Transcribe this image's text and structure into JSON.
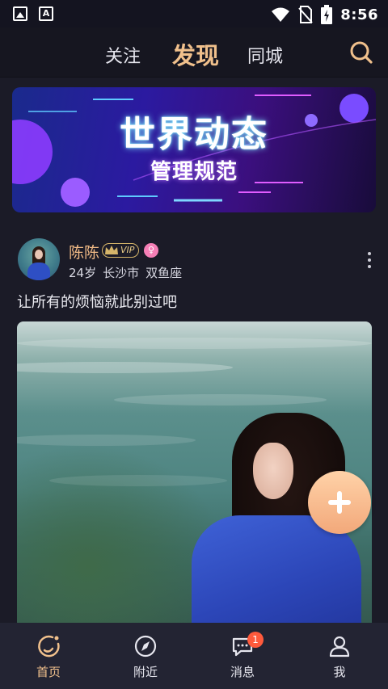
{
  "status_bar": {
    "time": "8:56",
    "left_icons": [
      "image-icon",
      "font-icon"
    ],
    "right_icons": [
      "wifi-icon",
      "no-sim-icon",
      "battery-icon"
    ]
  },
  "top_nav": {
    "tabs": [
      {
        "label": "关注"
      },
      {
        "label": "发现"
      },
      {
        "label": "同城"
      }
    ],
    "active_tab": "发现"
  },
  "banner": {
    "title": "世界动态",
    "subtitle": "管理规范"
  },
  "post": {
    "username": "陈陈",
    "vip_label": "VIP",
    "age": "24岁",
    "city": "长沙市",
    "zodiac": "双鱼座",
    "caption": "让所有的烦恼就此别过吧"
  },
  "bottom_nav": {
    "items": [
      {
        "label": "首页",
        "icon": "home-icon"
      },
      {
        "label": "附近",
        "icon": "compass-icon"
      },
      {
        "label": "消息",
        "icon": "chat-icon",
        "badge": "1"
      },
      {
        "label": "我",
        "icon": "profile-icon"
      }
    ]
  },
  "colors": {
    "accent": "#f0c08c",
    "background": "#1b1b27",
    "badge": "#ff5a3c",
    "fab": "#f2a87a"
  }
}
